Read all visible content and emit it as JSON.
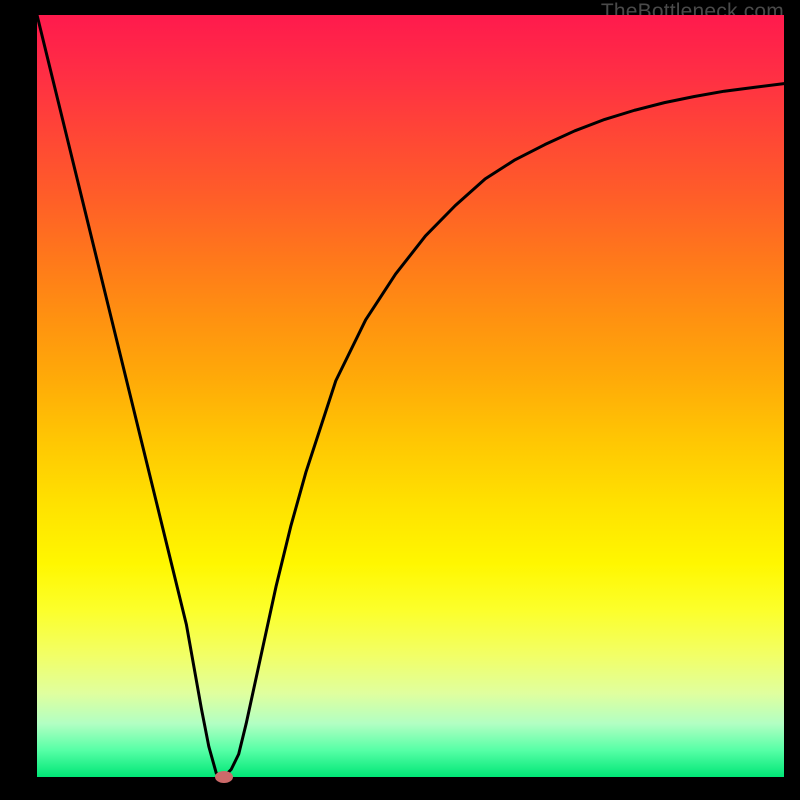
{
  "attribution": "TheBottleneck.com",
  "chart_data": {
    "type": "line",
    "title": "",
    "xlabel": "",
    "ylabel": "",
    "xlim": [
      0,
      100
    ],
    "ylim": [
      0,
      100
    ],
    "x": [
      0,
      2,
      4,
      6,
      8,
      10,
      12,
      14,
      16,
      18,
      20,
      22,
      23,
      24,
      25,
      26,
      27,
      28,
      30,
      32,
      34,
      36,
      38,
      40,
      44,
      48,
      52,
      56,
      60,
      64,
      68,
      72,
      76,
      80,
      84,
      88,
      92,
      96,
      100
    ],
    "values": [
      100,
      92,
      84,
      76,
      68,
      60,
      52,
      44,
      36,
      28,
      20,
      9,
      4,
      0.5,
      0,
      1,
      3,
      7,
      16,
      25,
      33,
      40,
      46,
      52,
      60,
      66,
      71,
      75,
      78.5,
      81,
      83,
      84.8,
      86.3,
      87.5,
      88.5,
      89.3,
      90,
      90.5,
      91
    ],
    "marker": {
      "x": 25,
      "y": 0
    },
    "background_gradient": [
      "#ff1a4d",
      "#ffe100",
      "#00e676"
    ],
    "annotations": []
  }
}
